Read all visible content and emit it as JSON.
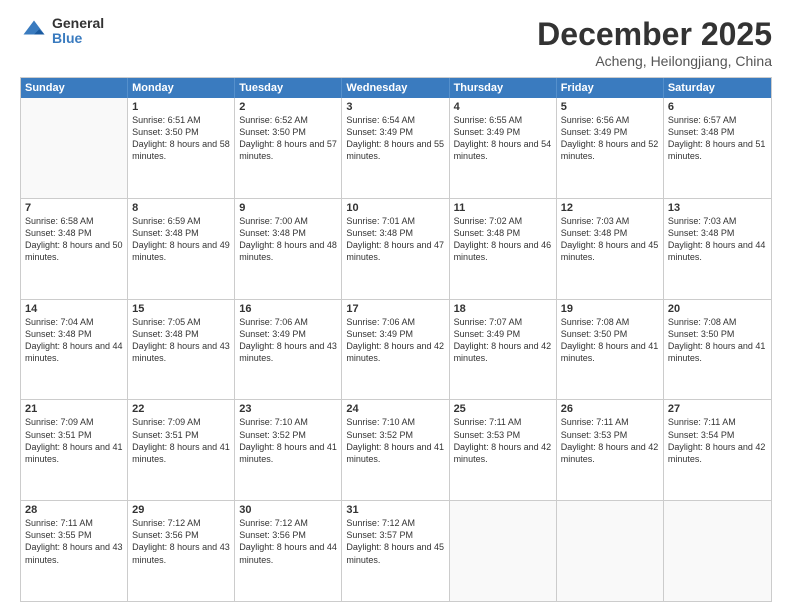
{
  "logo": {
    "general": "General",
    "blue": "Blue"
  },
  "title": {
    "month": "December 2025",
    "location": "Acheng, Heilongjiang, China"
  },
  "header_days": [
    "Sunday",
    "Monday",
    "Tuesday",
    "Wednesday",
    "Thursday",
    "Friday",
    "Saturday"
  ],
  "weeks": [
    [
      {
        "day": "",
        "sunrise": "",
        "sunset": "",
        "daylight": ""
      },
      {
        "day": "1",
        "sunrise": "Sunrise: 6:51 AM",
        "sunset": "Sunset: 3:50 PM",
        "daylight": "Daylight: 8 hours and 58 minutes."
      },
      {
        "day": "2",
        "sunrise": "Sunrise: 6:52 AM",
        "sunset": "Sunset: 3:50 PM",
        "daylight": "Daylight: 8 hours and 57 minutes."
      },
      {
        "day": "3",
        "sunrise": "Sunrise: 6:54 AM",
        "sunset": "Sunset: 3:49 PM",
        "daylight": "Daylight: 8 hours and 55 minutes."
      },
      {
        "day": "4",
        "sunrise": "Sunrise: 6:55 AM",
        "sunset": "Sunset: 3:49 PM",
        "daylight": "Daylight: 8 hours and 54 minutes."
      },
      {
        "day": "5",
        "sunrise": "Sunrise: 6:56 AM",
        "sunset": "Sunset: 3:49 PM",
        "daylight": "Daylight: 8 hours and 52 minutes."
      },
      {
        "day": "6",
        "sunrise": "Sunrise: 6:57 AM",
        "sunset": "Sunset: 3:48 PM",
        "daylight": "Daylight: 8 hours and 51 minutes."
      }
    ],
    [
      {
        "day": "7",
        "sunrise": "Sunrise: 6:58 AM",
        "sunset": "Sunset: 3:48 PM",
        "daylight": "Daylight: 8 hours and 50 minutes."
      },
      {
        "day": "8",
        "sunrise": "Sunrise: 6:59 AM",
        "sunset": "Sunset: 3:48 PM",
        "daylight": "Daylight: 8 hours and 49 minutes."
      },
      {
        "day": "9",
        "sunrise": "Sunrise: 7:00 AM",
        "sunset": "Sunset: 3:48 PM",
        "daylight": "Daylight: 8 hours and 48 minutes."
      },
      {
        "day": "10",
        "sunrise": "Sunrise: 7:01 AM",
        "sunset": "Sunset: 3:48 PM",
        "daylight": "Daylight: 8 hours and 47 minutes."
      },
      {
        "day": "11",
        "sunrise": "Sunrise: 7:02 AM",
        "sunset": "Sunset: 3:48 PM",
        "daylight": "Daylight: 8 hours and 46 minutes."
      },
      {
        "day": "12",
        "sunrise": "Sunrise: 7:03 AM",
        "sunset": "Sunset: 3:48 PM",
        "daylight": "Daylight: 8 hours and 45 minutes."
      },
      {
        "day": "13",
        "sunrise": "Sunrise: 7:03 AM",
        "sunset": "Sunset: 3:48 PM",
        "daylight": "Daylight: 8 hours and 44 minutes."
      }
    ],
    [
      {
        "day": "14",
        "sunrise": "Sunrise: 7:04 AM",
        "sunset": "Sunset: 3:48 PM",
        "daylight": "Daylight: 8 hours and 44 minutes."
      },
      {
        "day": "15",
        "sunrise": "Sunrise: 7:05 AM",
        "sunset": "Sunset: 3:48 PM",
        "daylight": "Daylight: 8 hours and 43 minutes."
      },
      {
        "day": "16",
        "sunrise": "Sunrise: 7:06 AM",
        "sunset": "Sunset: 3:49 PM",
        "daylight": "Daylight: 8 hours and 43 minutes."
      },
      {
        "day": "17",
        "sunrise": "Sunrise: 7:06 AM",
        "sunset": "Sunset: 3:49 PM",
        "daylight": "Daylight: 8 hours and 42 minutes."
      },
      {
        "day": "18",
        "sunrise": "Sunrise: 7:07 AM",
        "sunset": "Sunset: 3:49 PM",
        "daylight": "Daylight: 8 hours and 42 minutes."
      },
      {
        "day": "19",
        "sunrise": "Sunrise: 7:08 AM",
        "sunset": "Sunset: 3:50 PM",
        "daylight": "Daylight: 8 hours and 41 minutes."
      },
      {
        "day": "20",
        "sunrise": "Sunrise: 7:08 AM",
        "sunset": "Sunset: 3:50 PM",
        "daylight": "Daylight: 8 hours and 41 minutes."
      }
    ],
    [
      {
        "day": "21",
        "sunrise": "Sunrise: 7:09 AM",
        "sunset": "Sunset: 3:51 PM",
        "daylight": "Daylight: 8 hours and 41 minutes."
      },
      {
        "day": "22",
        "sunrise": "Sunrise: 7:09 AM",
        "sunset": "Sunset: 3:51 PM",
        "daylight": "Daylight: 8 hours and 41 minutes."
      },
      {
        "day": "23",
        "sunrise": "Sunrise: 7:10 AM",
        "sunset": "Sunset: 3:52 PM",
        "daylight": "Daylight: 8 hours and 41 minutes."
      },
      {
        "day": "24",
        "sunrise": "Sunrise: 7:10 AM",
        "sunset": "Sunset: 3:52 PM",
        "daylight": "Daylight: 8 hours and 41 minutes."
      },
      {
        "day": "25",
        "sunrise": "Sunrise: 7:11 AM",
        "sunset": "Sunset: 3:53 PM",
        "daylight": "Daylight: 8 hours and 42 minutes."
      },
      {
        "day": "26",
        "sunrise": "Sunrise: 7:11 AM",
        "sunset": "Sunset: 3:53 PM",
        "daylight": "Daylight: 8 hours and 42 minutes."
      },
      {
        "day": "27",
        "sunrise": "Sunrise: 7:11 AM",
        "sunset": "Sunset: 3:54 PM",
        "daylight": "Daylight: 8 hours and 42 minutes."
      }
    ],
    [
      {
        "day": "28",
        "sunrise": "Sunrise: 7:11 AM",
        "sunset": "Sunset: 3:55 PM",
        "daylight": "Daylight: 8 hours and 43 minutes."
      },
      {
        "day": "29",
        "sunrise": "Sunrise: 7:12 AM",
        "sunset": "Sunset: 3:56 PM",
        "daylight": "Daylight: 8 hours and 43 minutes."
      },
      {
        "day": "30",
        "sunrise": "Sunrise: 7:12 AM",
        "sunset": "Sunset: 3:56 PM",
        "daylight": "Daylight: 8 hours and 44 minutes."
      },
      {
        "day": "31",
        "sunrise": "Sunrise: 7:12 AM",
        "sunset": "Sunset: 3:57 PM",
        "daylight": "Daylight: 8 hours and 45 minutes."
      },
      {
        "day": "",
        "sunrise": "",
        "sunset": "",
        "daylight": ""
      },
      {
        "day": "",
        "sunrise": "",
        "sunset": "",
        "daylight": ""
      },
      {
        "day": "",
        "sunrise": "",
        "sunset": "",
        "daylight": ""
      }
    ]
  ]
}
